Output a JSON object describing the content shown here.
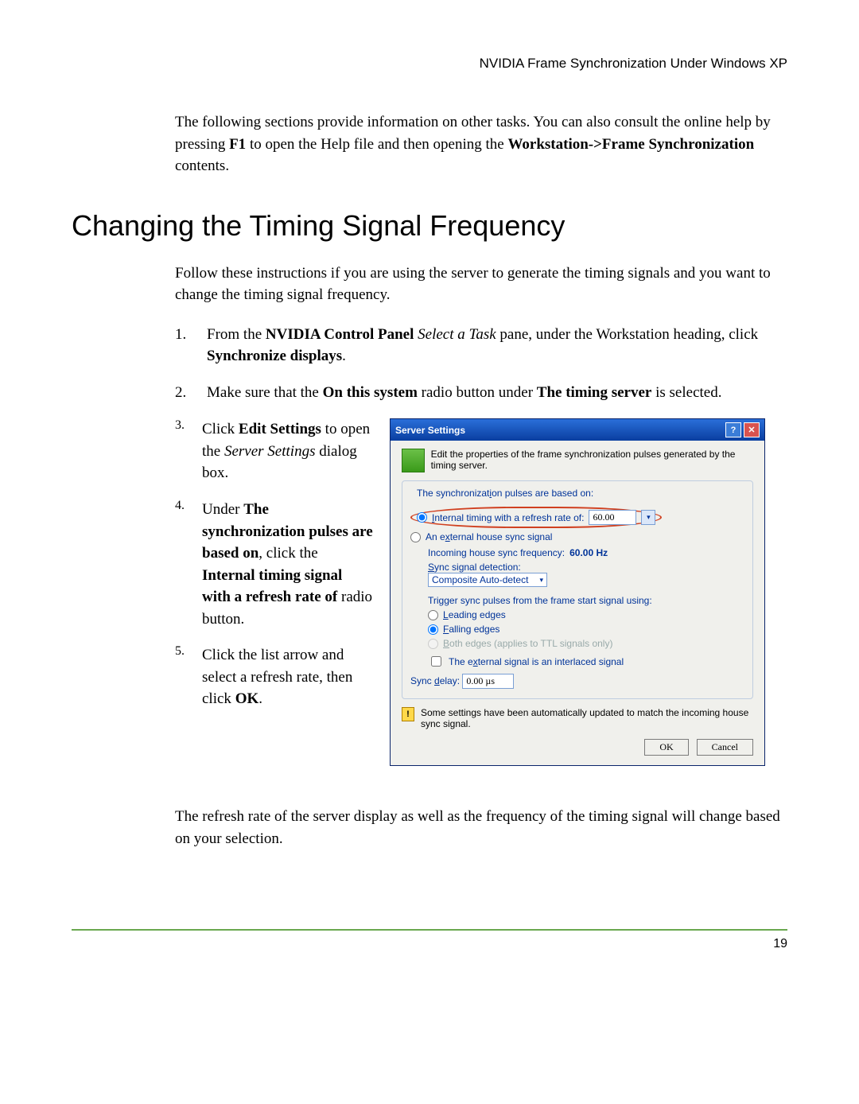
{
  "header": {
    "running": "NVIDIA Frame Synchronization Under Windows XP"
  },
  "intro": {
    "p1a": "The following sections provide information on other tasks. You can also consult the online help by pressing ",
    "p1key": "F1",
    "p1b": " to open the Help file and then opening the ",
    "p1path": "Workstation->Frame Synchronization",
    "p1c": " contents."
  },
  "heading": "Changing the Timing Signal Frequency",
  "lead": "Follow these instructions if you are using the server to generate the timing signals and you want to change the timing signal frequency.",
  "steps": {
    "s1": {
      "n": "1.",
      "a": "From the ",
      "b": "NVIDIA Control Panel",
      "c": " Select a Task",
      "d": " pane, under the Workstation heading, click ",
      "e": "Synchronize displays",
      "f": "."
    },
    "s2": {
      "n": "2.",
      "a": "Make sure that the ",
      "b": "On this system",
      "c": " radio button under ",
      "d": "The timing server",
      "e": " is selected."
    },
    "s3": {
      "n": "3.",
      "a": "Click ",
      "b": "Edit Settings",
      "c": " to open the ",
      "d": "Server Settings",
      "e": " dialog box."
    },
    "s4": {
      "n": "4.",
      "a": "Under ",
      "b": "The synchronization pulses are based on",
      "c": ", click the ",
      "d": "Internal timing signal with a refresh rate of",
      "e": " radio button."
    },
    "s5": {
      "n": "5.",
      "a": "Click the list arrow and select a refresh rate, then click ",
      "b": "OK",
      "c": "."
    }
  },
  "dialog": {
    "title": "Server Settings",
    "helpbtn": "?",
    "closebtn": "✕",
    "desc": "Edit the properties of the frame synchronization pulses generated by the timing server.",
    "legend1_prefix": "The synchronizat",
    "legend1_u": "i",
    "legend1_suffix": "on pulses are based on:",
    "opt_internal_u": "I",
    "opt_internal": "nternal timing with a refresh rate of:",
    "refresh_value": "60.00",
    "opt_external_a": "An e",
    "opt_external_u": "x",
    "opt_external_b": "ternal house sync signal",
    "incoming_label": "Incoming house sync frequency: ",
    "incoming_value": "60.00 Hz",
    "syncdet_u": "S",
    "syncdet_label": "ync signal detection:",
    "syncdet_value": "Composite Auto-detect",
    "trigger_label": "Trigger sync pulses from the frame start signal using:",
    "leading_u": "L",
    "leading": "eading edges",
    "falling_u": "F",
    "falling": "alling edges",
    "both_u": "B",
    "both": "oth edges (applies to TTL signals only)",
    "interlaced_a": "The e",
    "interlaced_u": "x",
    "interlaced_b": "ternal signal is an interlaced signal",
    "delay_a": "Sync ",
    "delay_u": "d",
    "delay_b": "elay:",
    "delay_value": "0.00 µs",
    "warn": "Some settings have been automatically updated to match the incoming house sync signal.",
    "ok": "OK",
    "cancel": "Cancel"
  },
  "closing": "The refresh rate of the server display as well as the frequency of the timing signal will change based on your selection.",
  "pagenum": "19"
}
